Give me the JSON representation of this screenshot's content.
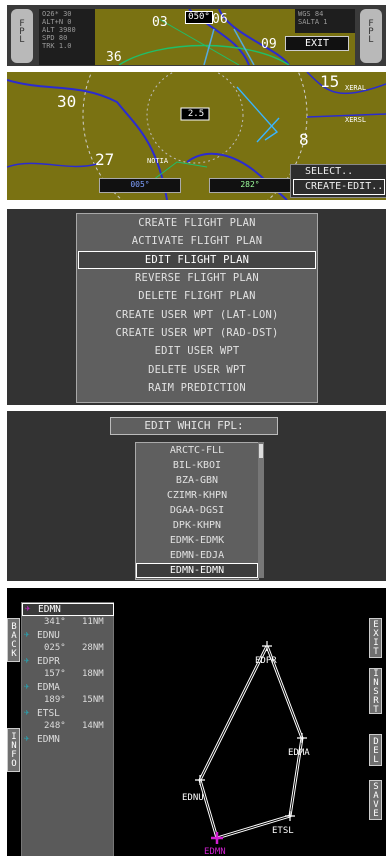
{
  "panel1": {
    "left_knob": "FPL",
    "right_knob": "FPL",
    "info_left": [
      "O26*  30",
      "ALT+N  0",
      "ALT  3980",
      "SPD  80",
      "TRK  1.0"
    ],
    "info_right": [
      "WGS 84",
      "SALTA  1"
    ],
    "heading": "050°",
    "labels": [
      "03",
      "06",
      "09",
      "36"
    ],
    "exit": "EXIT"
  },
  "panel2": {
    "labels": [
      "30",
      "27",
      "15",
      "8"
    ],
    "center": "2.5",
    "wpt_labels": [
      "XERAL",
      "XERSL",
      "NOTIA"
    ],
    "bottom_left": "005°",
    "bottom_right": "282°",
    "menu": [
      "SELECT..",
      "CREATE-EDIT.."
    ]
  },
  "fp_menu": {
    "items": [
      "CREATE FLIGHT PLAN",
      "ACTIVATE FLIGHT PLAN",
      "EDIT FLIGHT PLAN",
      "REVERSE FLIGHT PLAN",
      "DELETE FLIGHT PLAN",
      "CREATE USER WPT (LAT-LON)",
      "CREATE USER WPT (RAD-DST)",
      "EDIT USER WPT",
      "DELETE USER WPT",
      "RAIM PREDICTION"
    ]
  },
  "fpl_select": {
    "title": "EDIT WHICH FPL:",
    "items": [
      "ARCTC-FLL",
      "BIL-KBOI",
      "BZA-GBN",
      "CZIMR-KHPN",
      "DGAA-DGSI",
      "DPK-KHPN",
      "EDMK-EDMK",
      "EDMN-EDJA",
      "EDMN-EDMN"
    ]
  },
  "route": {
    "side_left": [
      "BACK",
      "INFO"
    ],
    "side_right": [
      "EXIT",
      "INSRT",
      "DEL",
      "SAVE"
    ],
    "waypoints": [
      {
        "name": "EDMN",
        "icon": "plane",
        "bearing": "341°",
        "dist": "11NM"
      },
      {
        "name": "EDNU",
        "icon": "plane",
        "bearing": "025°",
        "dist": "28NM"
      },
      {
        "name": "EDPR",
        "icon": "plane",
        "bearing": "157°",
        "dist": "18NM"
      },
      {
        "name": "EDMA",
        "icon": "plane",
        "bearing": "189°",
        "dist": "15NM"
      },
      {
        "name": "ETSL",
        "icon": "plane",
        "bearing": "248°",
        "dist": "14NM"
      },
      {
        "name": "EDMN",
        "icon": "plane",
        "bearing": null,
        "dist": null
      }
    ],
    "map_labels": [
      "EDPR",
      "EDMA",
      "EDNU",
      "ETSL",
      "EDMN"
    ]
  },
  "colors": {
    "map_ground": "#7a7212",
    "panel_bg": "#333333",
    "menu_bg": "#5f5f5f",
    "highlight_text": "#ffffff",
    "route_line": "#ffffff",
    "origin_marker": "#d020d0"
  }
}
